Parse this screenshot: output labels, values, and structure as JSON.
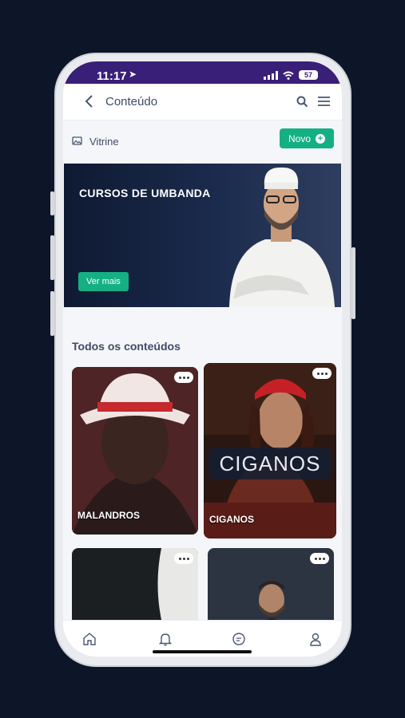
{
  "status": {
    "time": "11:17",
    "battery": "57"
  },
  "header": {
    "title": "Conteúdo"
  },
  "section": {
    "label": "Vitrine",
    "new_button": "Novo"
  },
  "banner": {
    "title": "CURSOS DE UMBANDA",
    "cta": "Ver mais"
  },
  "list": {
    "heading": "Todos os conteúdos",
    "items": [
      {
        "name": "MALANDROS"
      },
      {
        "name": "CIGANOS",
        "overlay_text": "CIGANOS"
      },
      {
        "name": ""
      },
      {
        "name": ""
      }
    ]
  },
  "nav": {
    "items": [
      "home-icon",
      "bell-icon",
      "chat-icon",
      "user-icon"
    ]
  },
  "colors": {
    "accent": "#14b083",
    "status_bar": "#3a1f78",
    "text": "#3f4a66"
  }
}
